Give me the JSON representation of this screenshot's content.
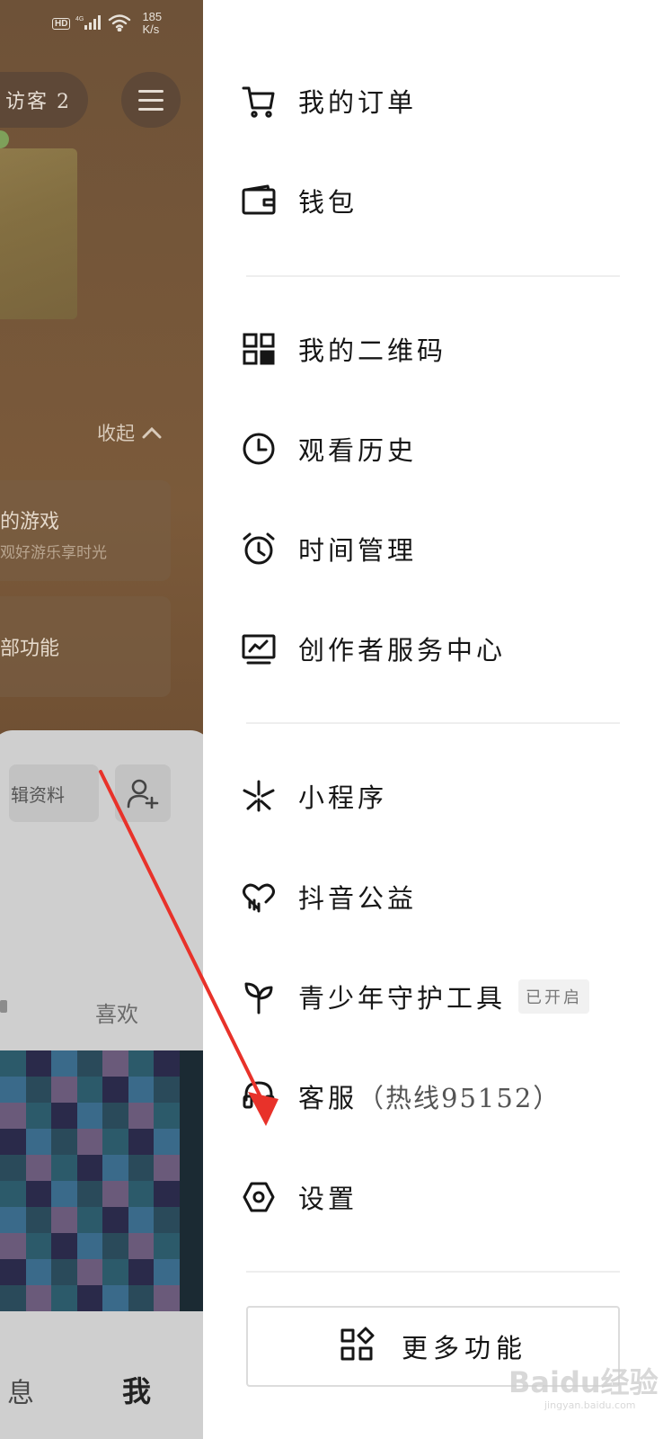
{
  "status_bar": {
    "hd": "HD",
    "network": "4G",
    "speed_value": "185",
    "speed_unit": "K/s"
  },
  "profile": {
    "visitor_label": "访客 2",
    "collapse_label": "收起",
    "cards": [
      {
        "title": "的游戏",
        "subtitle": "观好游乐享时光"
      },
      {
        "title": "部功能"
      }
    ],
    "edit_label": "辑资料",
    "tabs": {
      "likes": "喜欢"
    },
    "bottom_nav": {
      "messages": "息",
      "me": "我"
    }
  },
  "drawer": {
    "items": [
      {
        "label": "我的订单",
        "icon": "cart-icon"
      },
      {
        "label": "钱包",
        "icon": "wallet-icon"
      },
      {
        "label": "我的二维码",
        "icon": "qrcode-icon"
      },
      {
        "label": "观看历史",
        "icon": "clock-icon"
      },
      {
        "label": "时间管理",
        "icon": "alarm-clock-icon"
      },
      {
        "label": "创作者服务中心",
        "icon": "monitor-chart-icon"
      },
      {
        "label": "小程序",
        "icon": "mini-program-icon"
      },
      {
        "label": "抖音公益",
        "icon": "heart-charity-icon"
      },
      {
        "label": "青少年守护工具",
        "icon": "sprout-icon",
        "badge": "已开启"
      },
      {
        "label": "客服",
        "hotline": "（热线95152）",
        "icon": "headset-icon"
      },
      {
        "label": "设置",
        "icon": "settings-hex-icon"
      }
    ],
    "more_label": "更多功能"
  },
  "watermark": {
    "text": "Baidu经验",
    "sub": "jingyan.baidu.com"
  },
  "colors": {
    "arrow": "#e8322a",
    "drawer_bg": "#ffffff",
    "text": "#161616"
  }
}
